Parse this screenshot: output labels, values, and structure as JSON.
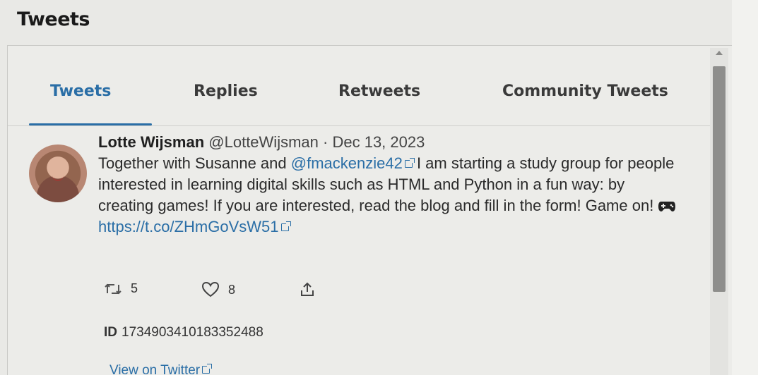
{
  "section": {
    "title": "Tweets"
  },
  "tabs": [
    {
      "label": "Tweets",
      "active": true
    },
    {
      "label": "Replies",
      "active": false
    },
    {
      "label": "Retweets",
      "active": false
    },
    {
      "label": "Community Tweets",
      "active": false
    }
  ],
  "tweet": {
    "author": "Lotte Wijsman",
    "handle": "@LotteWijsman",
    "separator": "·",
    "date": "Dec 13, 2023",
    "text_before": "Together with Susanne and ",
    "mention": "@fmackenzie42",
    "text_after": " I am starting a study group for people interested in learning digital skills such as HTML and Python in a fun way: by creating games! If you are interested, read the blog and fill in the form! Game on! ",
    "link": "https://t.co/ZHmGoVsW51",
    "retweets": "5",
    "likes": "8",
    "id_label": "ID",
    "id_value": "1734903410183352488",
    "view_link": "View on Twitter"
  },
  "colors": {
    "accent": "#2a6ea6",
    "background": "#ecece9",
    "text": "#2a2a2a"
  }
}
